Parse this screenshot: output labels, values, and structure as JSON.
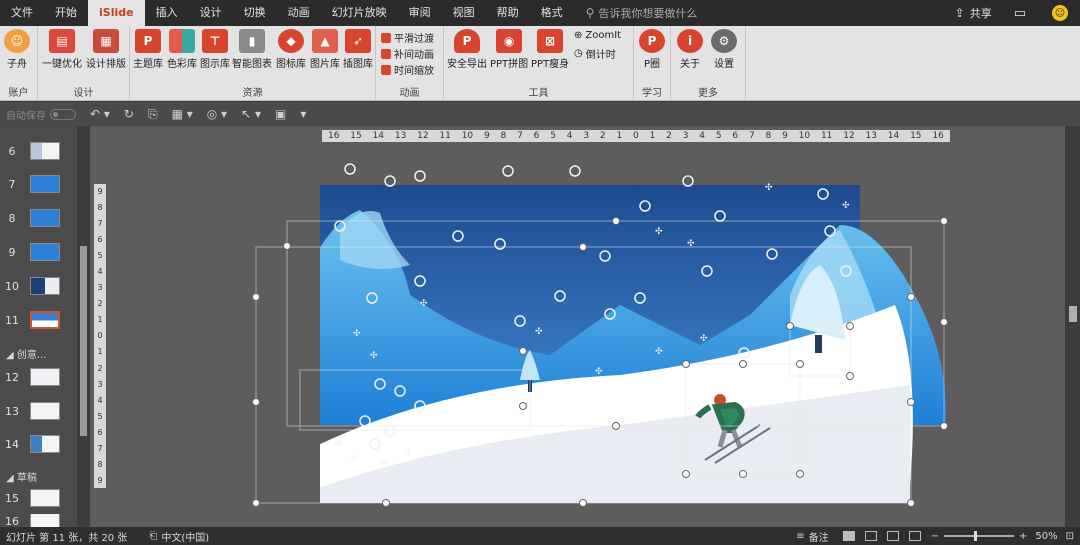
{
  "menu": {
    "tabs": [
      "文件",
      "开始",
      "iSlide",
      "插入",
      "设计",
      "切换",
      "动画",
      "幻灯片放映",
      "审阅",
      "视图",
      "帮助",
      "格式"
    ],
    "active_tab": "iSlide",
    "search_placeholder": "告诉我你想要做什么",
    "share_label": "共享"
  },
  "ribbon": {
    "account": {
      "user": "子舟",
      "label": "账户"
    },
    "design": {
      "label": "设计",
      "buttons": [
        "一键优化",
        "设计排版"
      ]
    },
    "resources": {
      "label": "资源",
      "buttons": [
        "主题库",
        "色彩库",
        "图示库",
        "智能图表",
        "图标库",
        "图片库",
        "插图库"
      ]
    },
    "animation": {
      "label": "动画",
      "buttons": [
        "平滑过渡",
        "补间动画",
        "时间缩放"
      ]
    },
    "tools": {
      "label": "工具",
      "buttons": [
        "安全导出",
        "PPT拼图",
        "PPT瘦身",
        "ZoomIt",
        "倒计时"
      ]
    },
    "learn": {
      "label": "学习",
      "buttons": [
        "P圈"
      ]
    },
    "more": {
      "label": "更多",
      "buttons": [
        "关于",
        "设置"
      ]
    }
  },
  "qat": {
    "autosave_label": "自动保存"
  },
  "slides_panel": {
    "items": [
      {
        "num": "6"
      },
      {
        "num": "7"
      },
      {
        "num": "8"
      },
      {
        "num": "9"
      },
      {
        "num": "10"
      },
      {
        "num": "11"
      },
      {
        "num": "12"
      },
      {
        "num": "13"
      },
      {
        "num": "14"
      },
      {
        "num": "15"
      },
      {
        "num": "16"
      }
    ],
    "sections": [
      "创意...",
      "草稿"
    ],
    "selected": "11"
  },
  "rulers": {
    "horizontal": [
      "16",
      "15",
      "14",
      "13",
      "12",
      "11",
      "10",
      "9",
      "8",
      "7",
      "6",
      "5",
      "4",
      "3",
      "2",
      "1",
      "0",
      "1",
      "2",
      "3",
      "4",
      "5",
      "6",
      "7",
      "8",
      "9",
      "10",
      "11",
      "12",
      "13",
      "14",
      "15",
      "16"
    ],
    "vertical": [
      "9",
      "8",
      "7",
      "6",
      "5",
      "4",
      "3",
      "2",
      "1",
      "0",
      "1",
      "2",
      "3",
      "4",
      "5",
      "6",
      "7",
      "8",
      "9"
    ]
  },
  "status": {
    "slide_info": "幻灯片 第 11 张，共 20 张",
    "language": "中文(中国)",
    "notes_label": "备注",
    "zoom": "50%"
  },
  "colors": {
    "accent": "#c43e1c",
    "sky_top": "#1e4a8f",
    "sky_bottom": "#3f86cf",
    "mountain": "#2a8fd9",
    "snow": "#ffffff"
  }
}
